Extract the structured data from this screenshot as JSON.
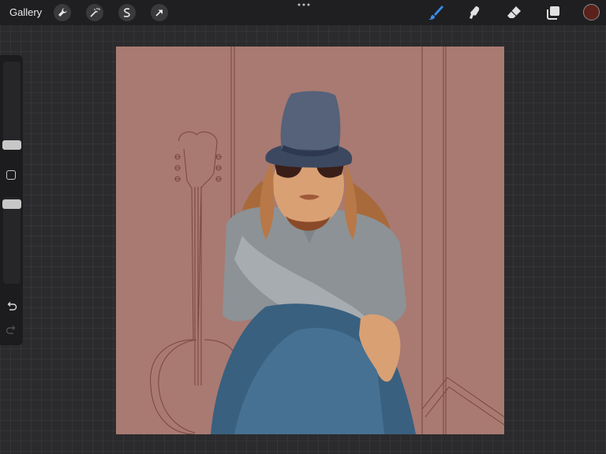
{
  "topbar": {
    "gallery_label": "Gallery",
    "tools": [
      "wrench-icon",
      "magic-wand-icon",
      "selection-icon",
      "transform-arrow-icon"
    ],
    "right_tools": [
      "brush-icon",
      "smudge-icon",
      "eraser-icon",
      "layers-icon"
    ],
    "active_tool": "brush",
    "current_color": "#5a221a"
  },
  "colors": {
    "canvas_background": "#a87a72",
    "active_accent": "#3a8be8"
  }
}
